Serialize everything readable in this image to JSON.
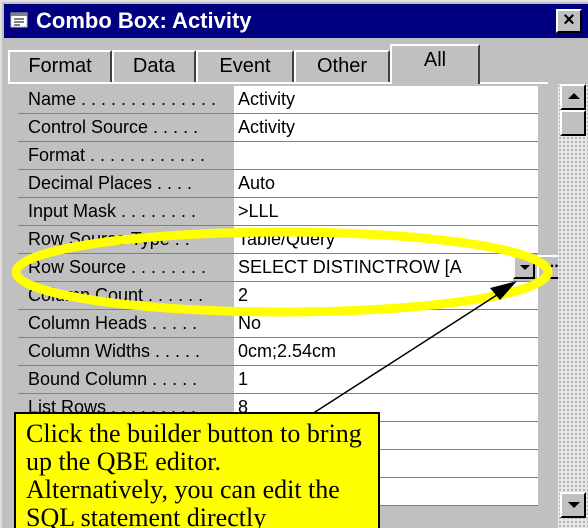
{
  "window": {
    "title": "Combo Box: Activity",
    "close_glyph": "×"
  },
  "tabs": [
    {
      "label": "Format"
    },
    {
      "label": "Data"
    },
    {
      "label": "Event"
    },
    {
      "label": "Other"
    },
    {
      "label": "All",
      "active": true
    }
  ],
  "properties": [
    {
      "label": "Name . . . . . . . . . . . . . .",
      "value": "Activity"
    },
    {
      "label": "Control Source . . . . .",
      "value": "Activity"
    },
    {
      "label": "Format . . . . . . . . . . . .",
      "value": ""
    },
    {
      "label": "Decimal Places . . . .",
      "value": "Auto"
    },
    {
      "label": "Input Mask . . . . . . . .",
      "value": ">LLL"
    },
    {
      "label": "Row Source Type . .",
      "value": "Table/Query"
    },
    {
      "label": "Row Source . . . . . . . .",
      "value": "SELECT DISTINCTROW [A"
    },
    {
      "label": "Column Count . . . . . .",
      "value": "2"
    },
    {
      "label": "Column Heads . . . . .",
      "value": "No"
    },
    {
      "label": "Column Widths . . . . .",
      "value": "0cm;2.54cm"
    },
    {
      "label": "Bound Column . . . . .",
      "value": "1"
    },
    {
      "label": "List Rows . . . . . . . . .",
      "value": "8"
    },
    {
      "label": "",
      "value": ""
    },
    {
      "label": "",
      "value": ""
    },
    {
      "label": "",
      "value": ""
    }
  ],
  "row_source_buttons": {
    "builder_label": "..."
  },
  "callout": {
    "text": "Click the builder button to bring up the QBE editor. Alternatively, you can edit the SQL statement directly"
  },
  "colors": {
    "title_bar": "#000080",
    "dialog_face": "#c0c0c0",
    "highlight_ellipse": "#ffff00",
    "callout_background": "#ffff00"
  },
  "icons": [
    "window-icon",
    "close-icon",
    "dropdown-arrow-icon",
    "builder-icon",
    "scroll-up-icon",
    "scroll-down-icon",
    "arrow-pointer-icon"
  ]
}
